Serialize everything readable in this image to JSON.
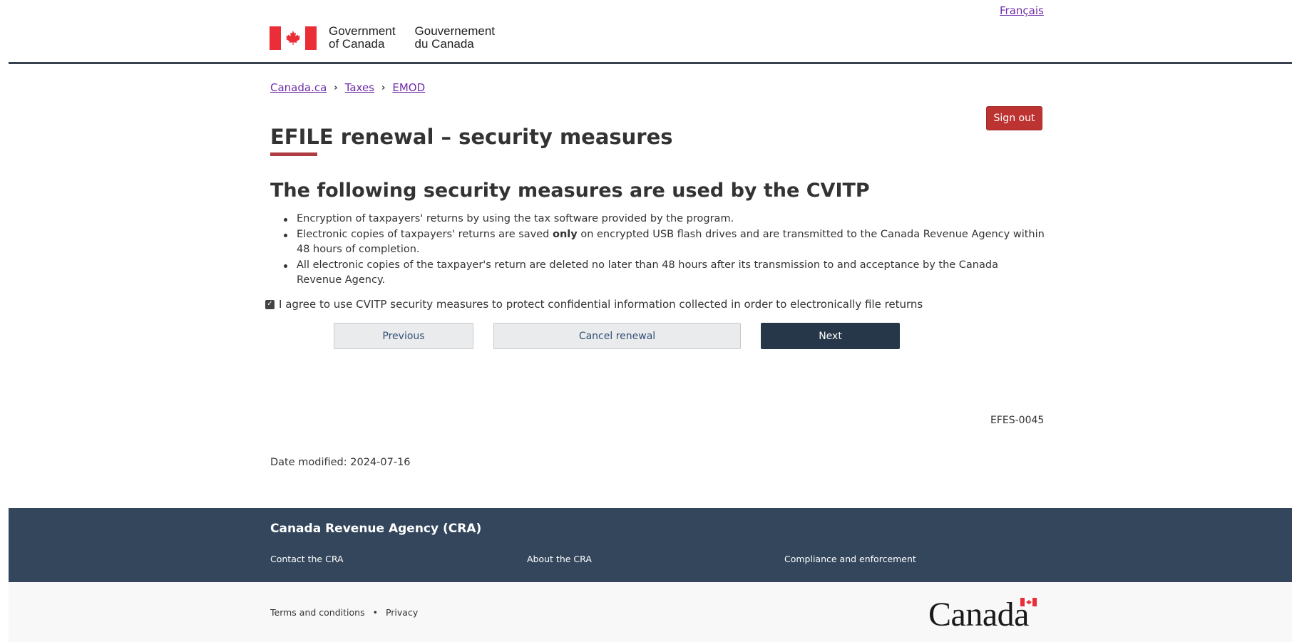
{
  "header": {
    "language_link": "Français",
    "signature_en_line1": "Government",
    "signature_en_line2": "of Canada",
    "signature_fr_line1": "Gouvernement",
    "signature_fr_line2": "du Canada"
  },
  "breadcrumb": {
    "items": [
      "Canada.ca",
      "Taxes",
      "EMOD"
    ]
  },
  "sign_out_label": "Sign out",
  "page_title": "EFILE renewal – security measures",
  "section_heading": "The following security measures are used by the CVITP",
  "measures": [
    {
      "text": "Encryption of taxpayers' returns by using the tax software provided by the program."
    },
    {
      "before": "Electronic copies of taxpayers' returns are saved ",
      "bold": "only",
      "after": " on encrypted USB flash drives and are transmitted to the Canada Revenue Agency within 48 hours of completion."
    },
    {
      "text": "All electronic copies of the taxpayer's return are deleted no later than 48 hours after its transmission to and acceptance by the Canada Revenue Agency."
    }
  ],
  "agreement": {
    "checked": true,
    "label": "I agree to use CVITP security measures to protect confidential information collected in order to electronically file returns"
  },
  "buttons": {
    "previous": "Previous",
    "cancel": "Cancel renewal",
    "next": "Next"
  },
  "page_id": "EFES-0045",
  "date_modified": "Date modified: 2024-07-16",
  "footer": {
    "title": "Canada Revenue Agency (CRA)",
    "links": [
      "Contact the CRA",
      "About the CRA",
      "Compliance and enforcement"
    ],
    "sub_links": [
      "Terms and conditions",
      "Privacy"
    ],
    "sub_separator": "•",
    "wordmark": "Canada"
  },
  "colors": {
    "flag_red": "#eb2d37",
    "link": "#6f2da8",
    "sign_out_bg": "#bc3331",
    "primary_button": "#26374a",
    "footer_bg": "#33465c",
    "title_accent": "#af3c43"
  }
}
